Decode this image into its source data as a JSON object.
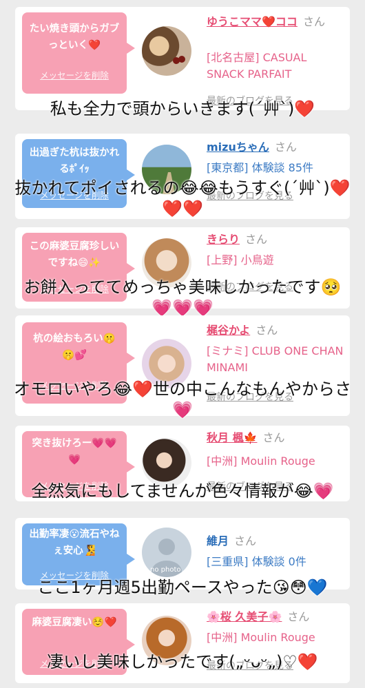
{
  "cards": [
    {
      "bubble": "たい焼き頭からガブっといく❤️",
      "delete_label": "メッセージを削除",
      "name": "ゆうこママ❤️ココ",
      "honorific": "さん",
      "location": "[北名古屋] CASUAL SNACK PARFAIT",
      "blog_link": "最新のブログを見る",
      "caption": "私も全力で頭からいきます(´艸`)❤️"
    },
    {
      "bubble": "出過ぎた杭は抜かれるﾎﾟｲｯ",
      "delete_label": "メッセージを削除",
      "name": "mizuちゃん",
      "honorific": "さん",
      "location": "[東京都] 体験談 85件",
      "blog_link": "最新のブログを見る",
      "caption": "抜かれてポイされるの😂😂もうすぐ(´艸`)❤️❤️❤️"
    },
    {
      "bubble": "この麻婆豆腐珍しいですね😄✨",
      "delete_label": "メッセージを削除",
      "name": "きらり",
      "honorific": "さん",
      "location": "[上野] 小鳥遊",
      "blog_link": "最新のブログを見る",
      "caption": "お餅入っててめっちゃ美味しかったです🥺💗💗💗"
    },
    {
      "bubble": "杭の絵おもろい🤫🤫💕",
      "delete_label": "メッセージを削除",
      "name": "梶谷かよ",
      "honorific": "さん",
      "location": "[ミナミ] CLUB ONE CHAN MINAMI",
      "blog_link": "最新のブログを見る",
      "caption": "オモロいやろ😂❤️世の中こんなもんやからさ💗"
    },
    {
      "bubble": "突き抜けろー💗💗💗",
      "delete_label": "メッセージを削除",
      "name": "秋月 楓🍁",
      "honorific": "さん",
      "location": "[中洲] Moulin Rouge",
      "blog_link": "最新のブログを見る",
      "caption": "全然気にもしてませんが色々情報が😂💗"
    },
    {
      "bubble": "出勤率凄😮流石やねぇ安心🧏",
      "delete_label": "メッセージを削除",
      "name": "維月",
      "honorific": "さん",
      "location": "[三重県] 体験談 0件",
      "blog_link": "",
      "avatar_text": "no photo",
      "caption": "ここ1ヶ月週5出勤ペースやった😘😳💙"
    },
    {
      "bubble": "麻婆豆腐凄い☺️❤️",
      "delete_label": "メッセージを削除",
      "name": "🌸桜 久美子🌸",
      "honorific": "さん",
      "location": "[中洲] Moulin Rouge",
      "blog_link": "最新のブログを見る",
      "caption": "凄いし美味しかったです(„ᵕᴗᵕ„)♡❤️"
    }
  ]
}
